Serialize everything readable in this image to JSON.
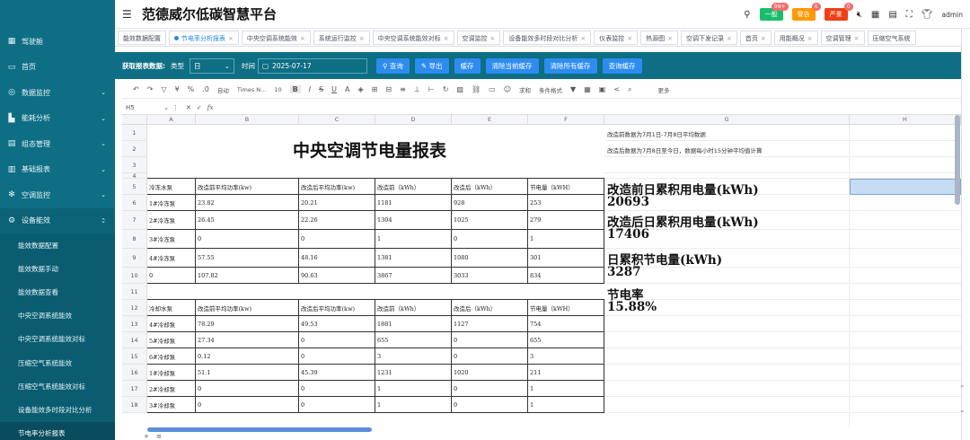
{
  "header": {
    "title": "范德威尔低碳智慧平台",
    "badges": [
      {
        "label": "一般",
        "count": "99+",
        "color": "#19be6b"
      },
      {
        "label": "警告",
        "count": "6",
        "color": "#ff9900"
      },
      {
        "label": "严重",
        "count": "0",
        "color": "#ed4014"
      }
    ],
    "user": "admin"
  },
  "sidebar": {
    "items": [
      {
        "label": "驾驶舱",
        "icon": "dashboard-icon",
        "chev": false
      },
      {
        "label": "首页",
        "icon": "monitor-icon",
        "chev": false
      },
      {
        "label": "数据监控",
        "icon": "target-icon",
        "chev": true
      },
      {
        "label": "能耗分析",
        "icon": "chart-icon",
        "chev": true
      },
      {
        "label": "组态管理",
        "icon": "grid-icon",
        "chev": true
      },
      {
        "label": "基础报表",
        "icon": "report-icon",
        "chev": true
      },
      {
        "label": "空调监控",
        "icon": "snow-icon",
        "chev": true
      },
      {
        "label": "设备能效",
        "icon": "device-icon",
        "chev": true
      }
    ],
    "sub_items": [
      "能效数据配置",
      "能效数据手动",
      "能效数据查看",
      "中央空调系统能效",
      "中央空调系统能效对标",
      "压缩空气系统能效",
      "压缩空气系统能效对标",
      "设备能效多时段对比分析",
      "节电率分析报表"
    ],
    "active_sub": "节电率分析报表"
  },
  "tabs": [
    {
      "label": "能效数据配置",
      "active": false
    },
    {
      "label": "节电率分析报表",
      "active": true
    },
    {
      "label": "中央空调系统能效",
      "active": false
    },
    {
      "label": "系统运行监控",
      "active": false
    },
    {
      "label": "中央空调系统能效对标",
      "active": false
    },
    {
      "label": "空调监控",
      "active": false
    },
    {
      "label": "设备能效多时段对比分析",
      "active": false
    },
    {
      "label": "仪表监控",
      "active": false
    },
    {
      "label": "热源图",
      "active": false
    },
    {
      "label": "空调下发记录",
      "active": false
    },
    {
      "label": "首页",
      "active": false
    },
    {
      "label": "用能概况",
      "active": false
    },
    {
      "label": "空调管理",
      "active": false
    },
    {
      "label": "压缩空气系统",
      "active": false
    }
  ],
  "filter": {
    "label": "获取报表数据:",
    "type_label": "类型",
    "type_value": "日",
    "time_label": "时间",
    "date_value": "2025-07-17",
    "buttons": [
      "查询",
      "导出",
      "缓存",
      "清除当前缓存",
      "清除所有缓存",
      "查询缓存"
    ]
  },
  "toolbar": {
    "font_format": "自动",
    "font_name": "Times N...",
    "font_size": "10",
    "bold": "B",
    "italic": "I",
    "strike": "S",
    "underline": "U",
    "sum_label": "求和",
    "cond_format": "条件格式",
    "more": "更多"
  },
  "formula_bar": {
    "cell_ref": "H5",
    "fx": "fx"
  },
  "sheet": {
    "col_letters": [
      "A",
      "B",
      "C",
      "D",
      "E",
      "F",
      "G",
      "H"
    ],
    "row_numbers": [
      "1",
      "2",
      "3",
      "4",
      "5",
      "6",
      "7",
      "8",
      "9",
      "10",
      "11",
      "12",
      "13",
      "14",
      "15",
      "16",
      "17",
      "18"
    ],
    "report_title": "中央空调节电量报表",
    "notes": [
      "改造前数据为7月1日-7月8日平均数据",
      "改造后数据为7月8日至今日，数据每小时15分钟平均值计算"
    ],
    "table1_header": [
      "冷冻水泵",
      "改造前平均功率(kw)",
      "改造后平均功率(kw)",
      "改造前（kWh）",
      "改造后（kWh）",
      "节电量（kWH）"
    ],
    "table1_rows": [
      [
        "1#冷冻泵",
        "23.82",
        "20.21",
        "1181",
        "928",
        "253"
      ],
      [
        "2#冷冻泵",
        "26.45",
        "22.26",
        "1304",
        "1025",
        "279"
      ],
      [
        "3#冷冻泵",
        "0",
        "0",
        "1",
        "0",
        "1"
      ],
      [
        "4#冷冻泵",
        "57.55",
        "48.16",
        "1381",
        "1080",
        "301"
      ],
      [
        "0",
        "107.82",
        "90.63",
        "3867",
        "3033",
        "834"
      ]
    ],
    "table2_header": [
      "冷却水泵",
      "改造前平均功率(kw)",
      "改造后平均功率(kw)",
      "改造前（kWh）",
      "改造后（kWh）",
      "节电量（kWH）"
    ],
    "table2_rows": [
      [
        "4#冷却泵",
        "78.29",
        "49.53",
        "1881",
        "1127",
        "754"
      ],
      [
        "5#冷却泵",
        "27.34",
        "0",
        "655",
        "0",
        "655"
      ],
      [
        "6#冷却泵",
        "0.12",
        "0",
        "3",
        "0",
        "3"
      ],
      [
        "1#冷却泵",
        "51.1",
        "45.39",
        "1231",
        "1020",
        "211"
      ],
      [
        "2#冷却泵",
        "0",
        "0",
        "1",
        "0",
        "1"
      ],
      [
        "3#冷却泵",
        "0",
        "0",
        "1",
        "0",
        "1"
      ]
    ],
    "kpis": [
      {
        "label": "改造前日累积用电量(kWh)",
        "value": "20693"
      },
      {
        "label": "改造后日累积用电量(kWh)",
        "value": "17406"
      },
      {
        "label": "日累积节电量(kWh)",
        "value": "3287"
      },
      {
        "label": "节电率",
        "value": "15.88%"
      }
    ]
  }
}
